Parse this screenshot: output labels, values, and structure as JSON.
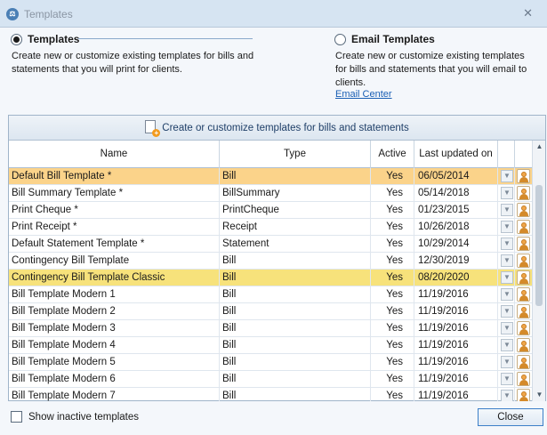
{
  "window": {
    "title": "Templates",
    "app_icon": "app-logo-icon",
    "close_glyph": "✕"
  },
  "options": {
    "templates": {
      "label": "Templates",
      "selected": true,
      "description": "Create new or customize existing templates for bills and statements that you will print for clients."
    },
    "email_templates": {
      "label": "Email Templates",
      "selected": false,
      "description": "Create new or customize existing templates for bills and statements that you will email to clients.",
      "link": "Email Center"
    }
  },
  "create_button": {
    "label": "Create or customize templates for bills and statements",
    "icon": "new-document-icon"
  },
  "grid": {
    "columns": [
      "Name",
      "Type",
      "Active",
      "Last updated on"
    ],
    "rows": [
      {
        "name": "Default Bill Template *",
        "type": "Bill",
        "active": "Yes",
        "date": "06/05/2014",
        "state": "selected"
      },
      {
        "name": "Bill Summary Template *",
        "type": "BillSummary",
        "active": "Yes",
        "date": "05/14/2018",
        "state": ""
      },
      {
        "name": "Print Cheque *",
        "type": "PrintCheque",
        "active": "Yes",
        "date": "01/23/2015",
        "state": ""
      },
      {
        "name": "Print Receipt *",
        "type": "Receipt",
        "active": "Yes",
        "date": "10/26/2018",
        "state": ""
      },
      {
        "name": "Default Statement Template *",
        "type": "Statement",
        "active": "Yes",
        "date": "10/29/2014",
        "state": ""
      },
      {
        "name": "Contingency Bill Template",
        "type": "Bill",
        "active": "Yes",
        "date": "12/30/2019",
        "state": ""
      },
      {
        "name": "Contingency Bill Template Classic",
        "type": "Bill",
        "active": "Yes",
        "date": "08/20/2020",
        "state": "highlight"
      },
      {
        "name": "Bill Template Modern 1",
        "type": "Bill",
        "active": "Yes",
        "date": "11/19/2016",
        "state": ""
      },
      {
        "name": "Bill Template Modern 2",
        "type": "Bill",
        "active": "Yes",
        "date": "11/19/2016",
        "state": ""
      },
      {
        "name": "Bill Template Modern 3",
        "type": "Bill",
        "active": "Yes",
        "date": "11/19/2016",
        "state": ""
      },
      {
        "name": "Bill Template Modern 4",
        "type": "Bill",
        "active": "Yes",
        "date": "11/19/2016",
        "state": ""
      },
      {
        "name": "Bill Template Modern 5",
        "type": "Bill",
        "active": "Yes",
        "date": "11/19/2016",
        "state": ""
      },
      {
        "name": "Bill Template Modern 6",
        "type": "Bill",
        "active": "Yes",
        "date": "11/19/2016",
        "state": ""
      },
      {
        "name": "Bill Template Modern 7",
        "type": "Bill",
        "active": "Yes",
        "date": "11/19/2016",
        "state": ""
      }
    ],
    "row_icons": [
      "dropdown-arrow-icon",
      "user-icon"
    ]
  },
  "footer": {
    "show_inactive_label": "Show inactive templates",
    "show_inactive_checked": false,
    "close_label": "Close"
  },
  "colors": {
    "selected_row": "#fbd38a",
    "highlight_row": "#f7e27b",
    "link": "#1a5fb4"
  }
}
